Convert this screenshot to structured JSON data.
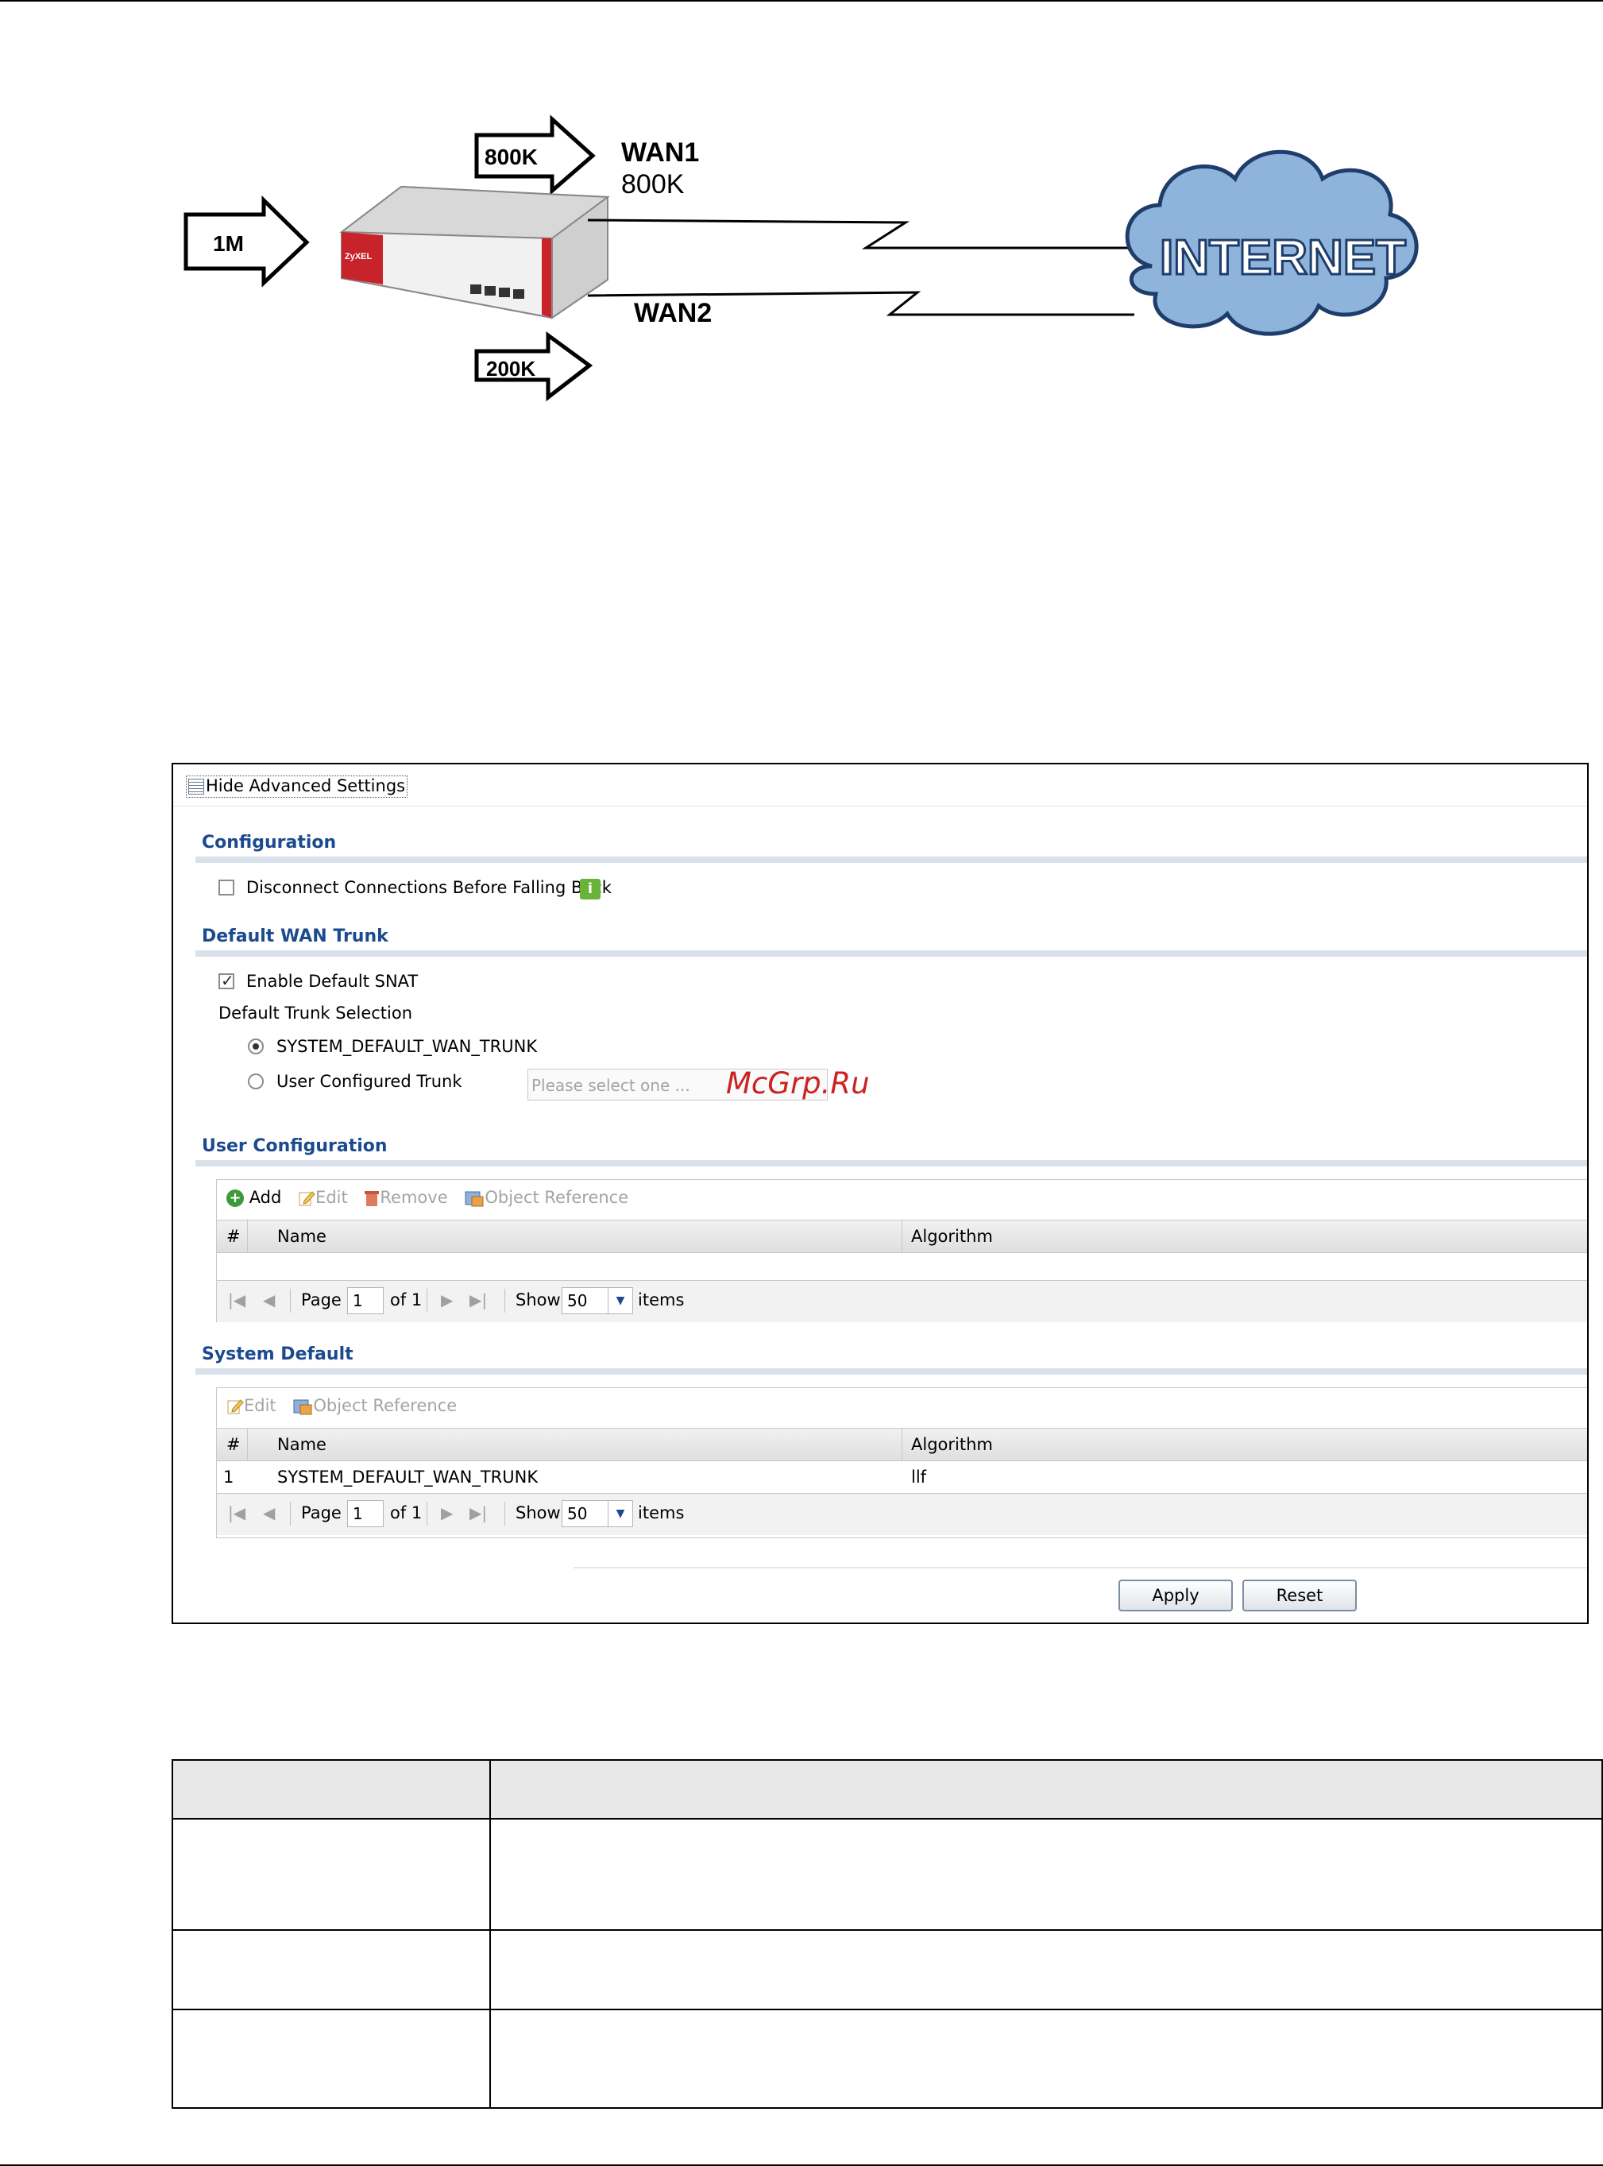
{
  "diagram": {
    "arrow_in": "1M",
    "arrow_wan1": "800K",
    "arrow_wan2": "200K",
    "wan1_label": "WAN1",
    "wan1_value": "800K",
    "wan2_label": "WAN2",
    "internet_label": "INTERNET",
    "device_logo": "ZyXEL"
  },
  "panel": {
    "advanced_toggle": "Hide Advanced Settings",
    "configuration": {
      "title": "Configuration",
      "disconnect_label": "Disconnect Connections Before Falling Back",
      "disconnect_checked": false
    },
    "default_wan_trunk": {
      "title": "Default WAN Trunk",
      "enable_snat_label": "Enable Default SNAT",
      "enable_snat_checked": true,
      "trunk_selection_label": "Default Trunk Selection",
      "option_system": "SYSTEM_DEFAULT_WAN_TRUNK",
      "option_user": "User Configured Trunk",
      "selected_option": "SYSTEM_DEFAULT_WAN_TRUNK",
      "user_trunk_placeholder": "Please select one ..."
    },
    "user_configuration": {
      "title": "User Configuration",
      "toolbar": {
        "add": "Add",
        "edit": "Edit",
        "remove": "Remove",
        "object_reference": "Object Reference"
      },
      "columns": [
        "#",
        "Name",
        "Algorithm"
      ],
      "rows": [],
      "pager": {
        "page_label": "Page",
        "page_value": "1",
        "of_label": "of 1",
        "show_label": "Show",
        "show_value": "50",
        "items_label": "items"
      }
    },
    "system_default": {
      "title": "System Default",
      "toolbar": {
        "edit": "Edit",
        "object_reference": "Object Reference"
      },
      "columns": [
        "#",
        "Name",
        "Algorithm"
      ],
      "rows": [
        {
          "num": "1",
          "name": "SYSTEM_DEFAULT_WAN_TRUNK",
          "algorithm": "llf"
        }
      ],
      "pager": {
        "page_label": "Page",
        "page_value": "1",
        "of_label": "of 1",
        "show_label": "Show",
        "show_value": "50",
        "items_label": "items"
      }
    },
    "buttons": {
      "apply": "Apply",
      "reset": "Reset"
    }
  },
  "watermark": "McGrp.Ru",
  "colors": {
    "section_title": "#1b4a8f",
    "watermark": "#cc2222",
    "device_red": "#c8232a"
  }
}
